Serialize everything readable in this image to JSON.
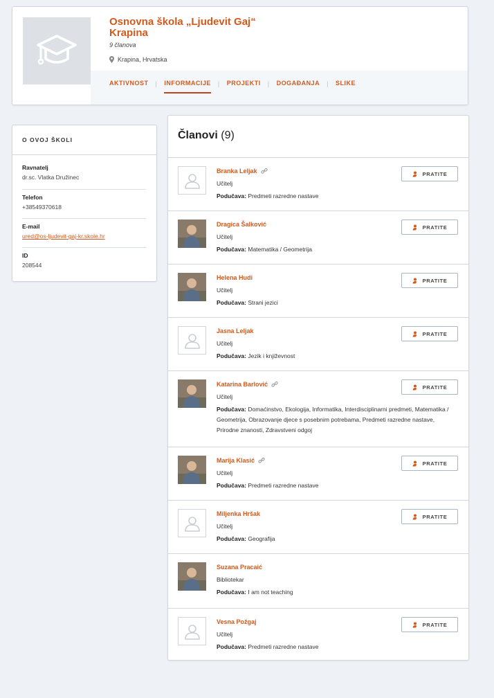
{
  "school": {
    "name": "Osnovna škola „Ljudevit Gaj“ Krapina",
    "members_count": "9 članova",
    "location": "Krapina, Hrvatska"
  },
  "tabs": [
    {
      "label": "AKTIVNOST"
    },
    {
      "label": "INFORMACIJE",
      "active": true
    },
    {
      "label": "PROJEKTI"
    },
    {
      "label": "DOGAĐANJA"
    },
    {
      "label": "SLIKE"
    }
  ],
  "about": {
    "heading": "O OVOJ ŠKOLI",
    "principal_label": "Ravnatelj",
    "principal_value": "dr.sc. Vlatka Družinec",
    "phone_label": "Telefon",
    "phone_value": "+38549370618",
    "email_label": "E-mail",
    "email_value": "ured@os-ljudevit-gaj-kr.skole.hr",
    "id_label": "ID",
    "id_value": "208544"
  },
  "members_section": {
    "title": "Članovi",
    "count": "(9)",
    "follow_label": "PRATITE",
    "teaches_label": "Podučava:"
  },
  "members": [
    {
      "name": "Branka Leljak",
      "role": "Učitelj",
      "teaches": "Predmeti razredne nastave",
      "photo": "placeholder",
      "linked": true,
      "follow": true
    },
    {
      "name": "Dragica Šalković",
      "role": "Učitelj",
      "teaches": "Matematika / Geometrija",
      "photo": "photo",
      "linked": false,
      "follow": true
    },
    {
      "name": "Helena Hudi",
      "role": "Učitelj",
      "teaches": "Strani jezici",
      "photo": "photo",
      "linked": false,
      "follow": true
    },
    {
      "name": "Jasna Leljak",
      "role": "Učitelj",
      "teaches": "Jezik i književnost",
      "photo": "placeholder",
      "linked": false,
      "follow": true
    },
    {
      "name": "Katarina Barlović",
      "role": "Učitelj",
      "teaches": "Domaćinstvo, Ekologija, Informatika, Interdisciplinarni predmeti, Matematika / Geometrija, Obrazovanje djece s posebnim potrebama, Predmeti razredne nastave, Prirodne znanosti, Zdravstveni odgoj",
      "photo": "photo",
      "linked": true,
      "follow": true
    },
    {
      "name": "Marija Klasić",
      "role": "Učitelj",
      "teaches": "Predmeti razredne nastave",
      "photo": "photo",
      "linked": true,
      "follow": true
    },
    {
      "name": "Miljenka Hršak",
      "role": "Učitelj",
      "teaches": "Geografija",
      "photo": "placeholder",
      "linked": false,
      "follow": true
    },
    {
      "name": "Suzana Pracaić",
      "role": "Bibliotekar",
      "teaches": "I am not teaching",
      "photo": "photo",
      "linked": false,
      "follow": false
    },
    {
      "name": "Vesna Požgaj",
      "role": "Učitelj",
      "teaches": "Predmeti razredne nastave",
      "photo": "placeholder",
      "linked": false,
      "follow": true
    }
  ],
  "colors": {
    "accent": "#d2591c",
    "tab_underline": "#c4411a",
    "background": "#eef1f5"
  }
}
